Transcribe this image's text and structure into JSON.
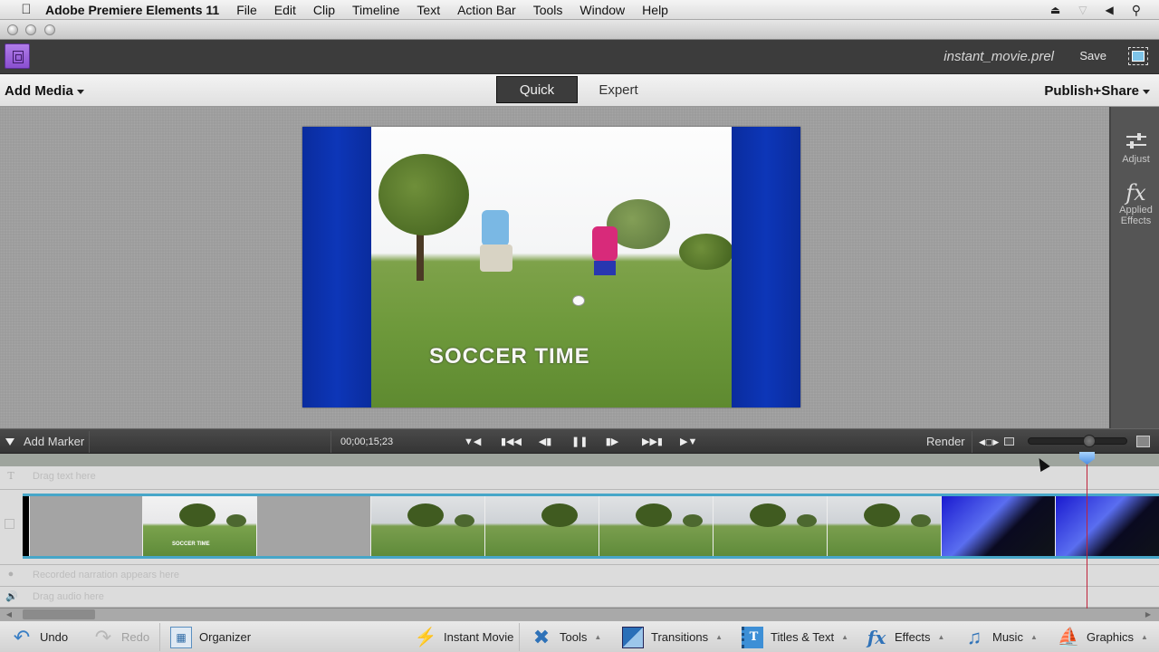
{
  "menubar": {
    "app_name": "Adobe Premiere Elements 11",
    "items": [
      "File",
      "Edit",
      "Clip",
      "Timeline",
      "Text",
      "Action Bar",
      "Tools",
      "Window",
      "Help"
    ],
    "status_icons": [
      "eject-icon",
      "wifi-icon",
      "volume-icon",
      "spotlight-search-icon"
    ]
  },
  "header": {
    "filename": "instant_movie.prel",
    "save_label": "Save"
  },
  "toolbar": {
    "add_media_label": "Add Media",
    "modes": [
      {
        "label": "Quick",
        "active": true
      },
      {
        "label": "Expert",
        "active": false
      }
    ],
    "publish_label": "Publish+Share"
  },
  "preview": {
    "title_text": "SOCCER TIME"
  },
  "right_panel": {
    "adjust_label": "Adjust",
    "fx_glyph": "fx",
    "applied_effects_label1": "Applied",
    "applied_effects_label2": "Effects"
  },
  "transport": {
    "add_marker_label": "Add Marker",
    "timecode": "00;00;15;23",
    "buttons": [
      "go-to-previous-edit",
      "go-to-start",
      "step-back",
      "pause",
      "step-forward",
      "go-to-end",
      "go-to-next-edit"
    ],
    "render_label": "Render",
    "zoom_level": 0.62
  },
  "timeline": {
    "text_track_hint": "Drag text here",
    "narration_hint": "Recorded narration appears here",
    "audio_hint": "Drag audio here",
    "clip_thumb_title": "SOCCER TIME"
  },
  "actionbar": {
    "undo": "Undo",
    "redo": "Redo",
    "organizer": "Organizer",
    "instant_movie": "Instant Movie",
    "tools": "Tools",
    "transitions": "Transitions",
    "titles_text": "Titles & Text",
    "effects": "Effects",
    "music": "Music",
    "graphics": "Graphics"
  },
  "colors": {
    "accent_purple": "#9a62de",
    "clip_border": "#47a6c8",
    "playhead": "#c0223a"
  }
}
